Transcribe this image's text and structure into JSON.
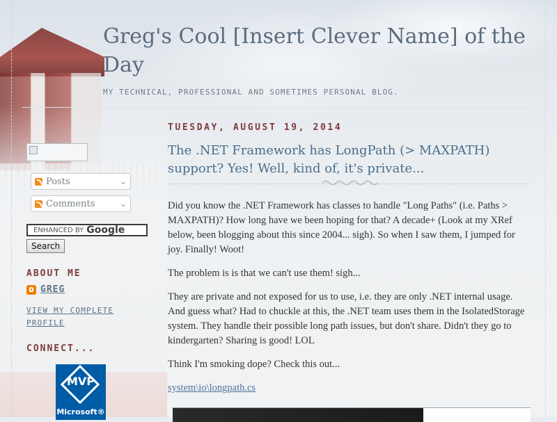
{
  "blog": {
    "title": "Greg's Cool [Insert Clever Name] of the Day",
    "description": "MY TECHNICAL, PROFESSIONAL AND SOMETIMES PERSONAL BLOG."
  },
  "sidebar": {
    "feeds": [
      {
        "label": "Posts",
        "icon": "rss-icon"
      },
      {
        "label": "Comments",
        "icon": "rss-icon"
      }
    ],
    "search": {
      "placeholder_prefix": "ENHANCED BY",
      "brand": "Google",
      "button_label": "Search"
    },
    "about": {
      "heading": "ABOUT ME",
      "name": "GREG",
      "profile_link": "VIEW MY COMPLETE PROFILE"
    },
    "connect": {
      "heading": "CONNECT...",
      "badge_text": "MVP",
      "badge_sub": "Microsoft®"
    }
  },
  "post": {
    "date": "TUESDAY, AUGUST 19, 2014",
    "title": "The .NET Framework has LongPath (> MAXPATH) support? Yes! Well, kind of, it's private...",
    "paragraphs": [
      "Did you know the .NET Framework has classes to handle \"Long Paths\" (i.e. Paths > MAXPATH)? How long have we been hoping for that? A decade+ (Look at my XRef below, been blogging about this since 2004... sigh). So when I saw them, I jumped for joy. Finally! Woot!",
      "The problem is is that we can't use them! sigh...",
      "They are private and not exposed for us to use, i.e. they are only .NET internal usage. And guess what? Had to chuckle at this, the .NET team uses them in the IsolatedStorage system. They handle their possible long path issues, but don't share. Didn't they go to kindergarten? Sharing is good! LOL",
      "Think I'm smoking dope? Check this out..."
    ],
    "link": "system\\io\\longpath.cs"
  },
  "colors": {
    "title": "#5b6c7d",
    "heading_red": "#7d3b38",
    "link_blue": "#5270a0",
    "post_title": "#4a6d8c"
  }
}
